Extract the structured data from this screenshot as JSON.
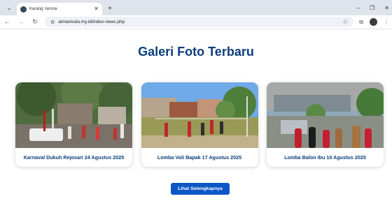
{
  "browser": {
    "tab_title": "Karang Taruna",
    "url": "atmamuda.my.id/index-news.php"
  },
  "page": {
    "heading": "Galeri Foto Terbaru",
    "gallery": [
      {
        "caption": "Karnaval Dukuh Rejosari 24 Agustus 2025"
      },
      {
        "caption": "Lomba Voli Bapak 17 Agustus 2025"
      },
      {
        "caption": "Lomba Balon Ibu 10 Agustus 2025"
      }
    ],
    "more_button_label": "Lihat Selengkapnya"
  },
  "colors": {
    "heading": "#0b3d7a",
    "button": "#0c57c6"
  }
}
